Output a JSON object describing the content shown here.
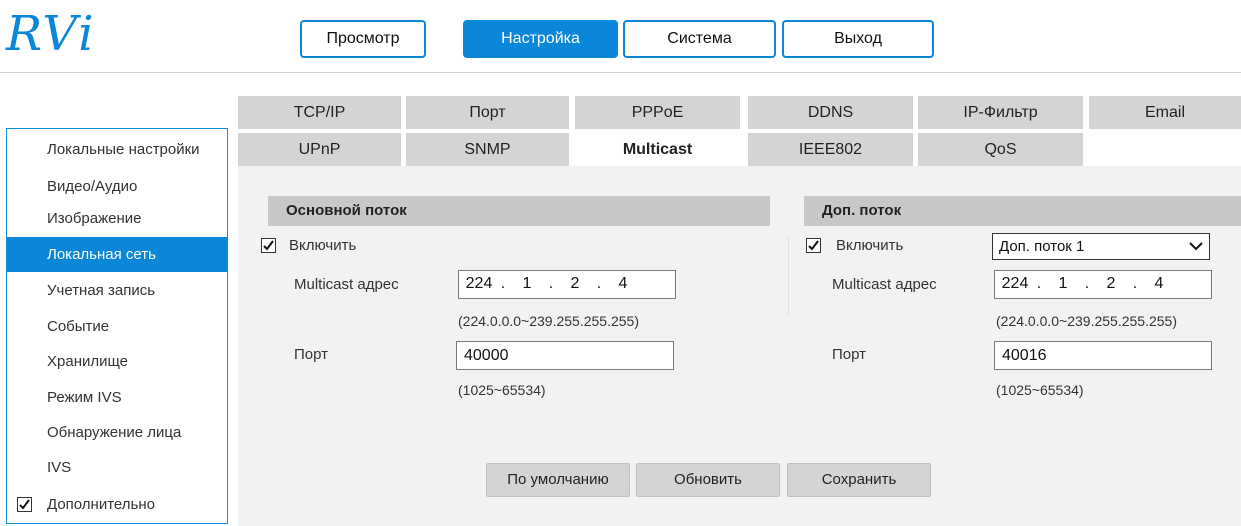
{
  "brand": {
    "logo_text": "RVi",
    "accent": "#0a87d9"
  },
  "top_nav": [
    "Просмотр",
    "Настройка",
    "Система",
    "Выход"
  ],
  "top_nav_active": "Настройка",
  "sidebar": {
    "items": [
      "Локальные настройки",
      "Видео/Аудио",
      "Изображение",
      "Локальная сеть",
      "Учетная запись",
      "Событие",
      "Хранилище",
      "Режим IVS",
      "Обнаружение лица",
      "IVS",
      "Дополнительно"
    ],
    "active": "Локальная сеть"
  },
  "tabs": {
    "row1": [
      "TCP/IP",
      "Порт",
      "PPPoE",
      "DDNS",
      "IP-Фильтр",
      "Email"
    ],
    "row2": [
      "UPnP",
      "SNMP",
      "Multicast",
      "IEEE802",
      "QoS"
    ],
    "active": "Multicast"
  },
  "main_stream": {
    "header": "Основной поток",
    "enable_label": "Включить",
    "enabled": true,
    "address_label": "Multicast адрес",
    "address": [
      "224",
      "1",
      "2",
      "4"
    ],
    "address_hint": "(224.0.0.0~239.255.255.255)",
    "port_label": "Порт",
    "port": "40000",
    "port_hint": "(1025~65534)"
  },
  "sub_stream": {
    "header": "Доп. поток",
    "enable_label": "Включить",
    "enabled": true,
    "stream_select": "Доп. поток 1",
    "address_label": "Multicast адрес",
    "address": [
      "224",
      "1",
      "2",
      "4"
    ],
    "address_hint": "(224.0.0.0~239.255.255.255)",
    "port_label": "Порт",
    "port": "40016",
    "port_hint": "(1025~65534)"
  },
  "actions": {
    "default": "По умолчанию",
    "refresh": "Обновить",
    "save": "Сохранить"
  }
}
